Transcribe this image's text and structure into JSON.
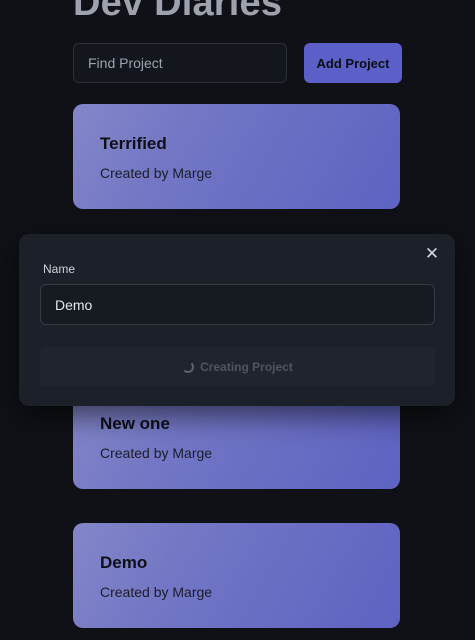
{
  "header": {
    "title": "Dev Diaries"
  },
  "toolbar": {
    "search_placeholder": "Find Project",
    "add_label": "Add Project"
  },
  "projects": [
    {
      "title": "Terrified",
      "subtitle": "Created by Marge"
    },
    {
      "title": "New one",
      "subtitle": "Created by Marge"
    },
    {
      "title": "Demo",
      "subtitle": "Created by Marge"
    }
  ],
  "modal": {
    "close_glyph": "✕",
    "name_label": "Name",
    "name_value": "Demo",
    "submit_label": "Creating Project",
    "submit_state": "loading"
  },
  "colors": {
    "background": "#0f1117",
    "accent": "#5b5fc7",
    "card_gradient_start": "#8386c8",
    "card_gradient_end": "#5e62c2",
    "modal_bg": "#1c2028"
  },
  "icons": {
    "close": "close-icon",
    "spinner": "spinner-icon"
  }
}
